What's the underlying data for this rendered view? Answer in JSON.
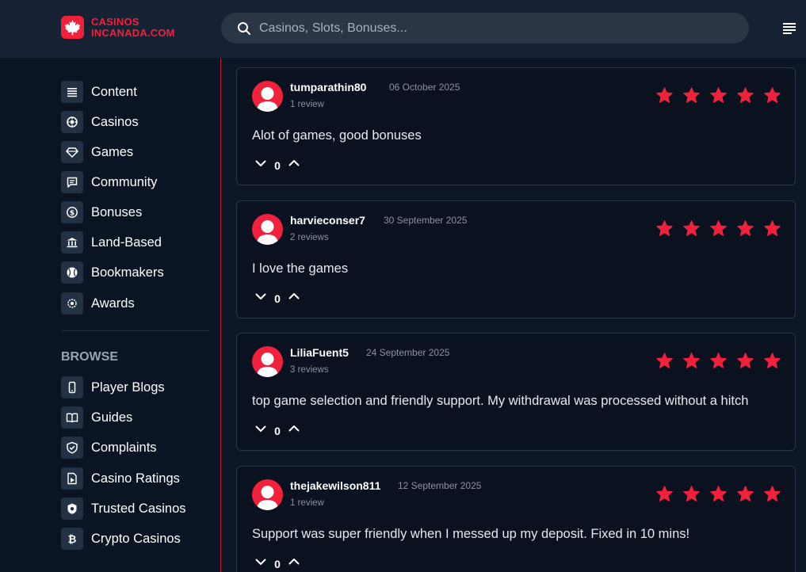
{
  "header": {
    "logo_line1": "CASINOS",
    "logo_line2": "INCANADA.COM",
    "search_placeholder": "Casinos, Slots, Bonuses..."
  },
  "colors": {
    "accent": "#f2213b",
    "background": "#0d1626",
    "header": "#162134",
    "card": "#0a1220"
  },
  "sidebar": {
    "main_items": [
      {
        "label": "Content",
        "icon": "list-icon"
      },
      {
        "label": "Casinos",
        "icon": "chip-icon"
      },
      {
        "label": "Games",
        "icon": "diamond-icon"
      },
      {
        "label": "Community",
        "icon": "chat-icon"
      },
      {
        "label": "Bonuses",
        "icon": "dollar-icon"
      },
      {
        "label": "Land-Based",
        "icon": "bank-icon"
      },
      {
        "label": "Bookmakers",
        "icon": "ball-icon"
      },
      {
        "label": "Awards",
        "icon": "award-icon"
      }
    ],
    "browse_label": "BROWSE",
    "browse_items": [
      {
        "label": "Player Blogs",
        "icon": "phone-icon"
      },
      {
        "label": "Guides",
        "icon": "book-icon"
      },
      {
        "label": "Complaints",
        "icon": "shield-icon"
      },
      {
        "label": "Casino Ratings",
        "icon": "rating-icon"
      },
      {
        "label": "Trusted Casinos",
        "icon": "trusted-icon"
      },
      {
        "label": "Crypto Casinos",
        "icon": "bitcoin-icon"
      }
    ]
  },
  "reviews": [
    {
      "username": "tumparathin80",
      "date": "06 October 2025",
      "review_count": "1 review",
      "text": "Alot of games, good bonuses",
      "votes": "0",
      "rating": 5
    },
    {
      "username": "harvieconser7",
      "date": "30 September 2025",
      "review_count": "2 reviews",
      "text": "I love the games",
      "votes": "0",
      "rating": 5
    },
    {
      "username": "LiliaFuent5",
      "date": "24 September 2025",
      "review_count": "3 reviews",
      "text": "top game selection and friendly support. My withdrawal was processed without a hitch",
      "votes": "0",
      "rating": 5
    },
    {
      "username": "thejakewilson811",
      "date": "12 September 2025",
      "review_count": "1 review",
      "text": "Support was super friendly when I messed up my deposit. Fixed in 10 mins!",
      "votes": "0",
      "rating": 5
    }
  ]
}
